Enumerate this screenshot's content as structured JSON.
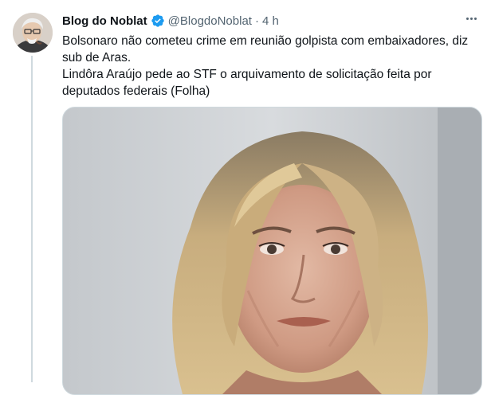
{
  "tweet": {
    "author_name": "Blog do Noblat",
    "handle": "@BlogdoNoblat",
    "separator": "·",
    "time": "4 h",
    "lines": [
      "Bolsonaro não cometeu crime em reunião golpista com embaixadores, diz sub de Aras.",
      "Lindôra Araújo pede ao STF o arquivamento de solicitação feita por deputados federais (Folha)"
    ]
  },
  "colors": {
    "verified": "#1d9bf0",
    "secondary_text": "#536471",
    "border": "#cfd9de"
  },
  "icons": {
    "verified": "verified-badge-icon",
    "more": "more-options-icon"
  }
}
